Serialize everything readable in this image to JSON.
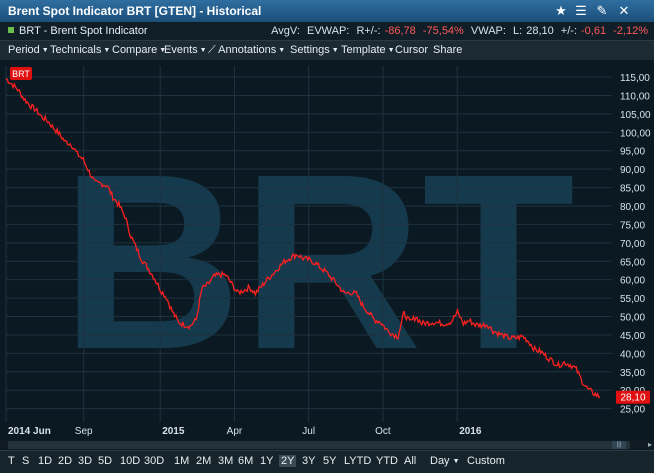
{
  "window": {
    "title": "Brent Spot Indicator BRT [GTEN] - Historical",
    "icons": [
      "star-icon",
      "menu-icon",
      "tool-icon",
      "close-icon"
    ]
  },
  "info": {
    "instrument": "BRT - Brent Spot Indicator",
    "avgv_label": "AvgV:",
    "evwap_label": "EVWAP:",
    "r_change_label": "R+/-:",
    "r_change_value": "-86,78",
    "r_change_pct": "-75,54%",
    "vwap_label": "VWAP:",
    "last_label": "L:",
    "last_value": "28,10",
    "change_label": "+/-:",
    "change_value": "-0,61",
    "change_pct": "-2,12%"
  },
  "menu": {
    "period": "Period",
    "technicals": "Technicals",
    "compare": "Compare",
    "events": "Events",
    "annotations": "Annotations",
    "settings": "Settings",
    "template": "Template",
    "cursor": "Cursor",
    "share": "Share"
  },
  "chart_data": {
    "type": "line",
    "watermark": "BRT",
    "series_tag": "BRT",
    "last_price_label": "28,10",
    "line_color": "#ff2020",
    "ylim": [
      23,
      118
    ],
    "y_ticks": [
      "25,00",
      "30,00",
      "35,00",
      "40,00",
      "45,00",
      "50,00",
      "55,00",
      "60,00",
      "65,00",
      "70,00",
      "75,00",
      "80,00",
      "85,00",
      "90,00",
      "95,00",
      "100,00",
      "105,00",
      "110,00",
      "115,00"
    ],
    "y_tick_values": [
      25,
      30,
      35,
      40,
      45,
      50,
      55,
      60,
      65,
      70,
      75,
      80,
      85,
      90,
      95,
      100,
      105,
      110,
      115
    ],
    "x_ticks": [
      {
        "label": "2014 Jun",
        "t": 0
      },
      {
        "label": "Sep",
        "t": 0.1308
      },
      {
        "label": "2015",
        "t": 0.2596
      },
      {
        "label": "Apr",
        "t": 0.3846
      },
      {
        "label": "Jul",
        "t": 0.5096
      },
      {
        "label": "Oct",
        "t": 0.6346
      },
      {
        "label": "2016",
        "t": 0.7596
      }
    ],
    "points": [
      [
        0.0,
        114.6
      ],
      [
        0.01,
        113.1
      ],
      [
        0.02,
        111.6
      ],
      [
        0.03,
        109.2
      ],
      [
        0.04,
        107.4
      ],
      [
        0.05,
        106.1
      ],
      [
        0.06,
        104.2
      ],
      [
        0.07,
        103.1
      ],
      [
        0.08,
        101.2
      ],
      [
        0.09,
        99.5
      ],
      [
        0.1,
        97.4
      ],
      [
        0.11,
        96.8
      ],
      [
        0.12,
        94.1
      ],
      [
        0.13,
        92.6
      ],
      [
        0.14,
        89.3
      ],
      [
        0.15,
        86.2
      ],
      [
        0.16,
        86.1
      ],
      [
        0.17,
        85.6
      ],
      [
        0.18,
        82.4
      ],
      [
        0.19,
        80.3
      ],
      [
        0.2,
        77.3
      ],
      [
        0.21,
        71.9
      ],
      [
        0.22,
        68.4
      ],
      [
        0.23,
        65.1
      ],
      [
        0.24,
        62.9
      ],
      [
        0.25,
        60.4
      ],
      [
        0.26,
        57.3
      ],
      [
        0.27,
        55.2
      ],
      [
        0.28,
        51.4
      ],
      [
        0.29,
        48.5
      ],
      [
        0.3,
        47.8
      ],
      [
        0.31,
        47.4
      ],
      [
        0.32,
        49.1
      ],
      [
        0.33,
        57.6
      ],
      [
        0.34,
        58.7
      ],
      [
        0.35,
        60.8
      ],
      [
        0.36,
        61.4
      ],
      [
        0.37,
        61.2
      ],
      [
        0.38,
        58.9
      ],
      [
        0.39,
        56.4
      ],
      [
        0.4,
        57.1
      ],
      [
        0.41,
        57.9
      ],
      [
        0.42,
        56.3
      ],
      [
        0.43,
        58.2
      ],
      [
        0.44,
        60.1
      ],
      [
        0.45,
        61.7
      ],
      [
        0.46,
        63.5
      ],
      [
        0.47,
        65.1
      ],
      [
        0.48,
        66.1
      ],
      [
        0.49,
        66.9
      ],
      [
        0.5,
        65.8
      ],
      [
        0.51,
        65.4
      ],
      [
        0.52,
        64.6
      ],
      [
        0.53,
        63.2
      ],
      [
        0.54,
        61.9
      ],
      [
        0.55,
        60.1
      ],
      [
        0.56,
        58.2
      ],
      [
        0.57,
        56.2
      ],
      [
        0.58,
        56.6
      ],
      [
        0.59,
        56.1
      ],
      [
        0.6,
        53.1
      ],
      [
        0.61,
        51.2
      ],
      [
        0.62,
        49.1
      ],
      [
        0.63,
        48.6
      ],
      [
        0.64,
        46.6
      ],
      [
        0.65,
        45.3
      ],
      [
        0.66,
        44.6
      ],
      [
        0.67,
        50.9
      ],
      [
        0.68,
        48.5
      ],
      [
        0.69,
        49.9
      ],
      [
        0.7,
        48.1
      ],
      [
        0.71,
        48.3
      ],
      [
        0.72,
        48.5
      ],
      [
        0.73,
        48.2
      ],
      [
        0.74,
        48.1
      ],
      [
        0.75,
        48.7
      ],
      [
        0.76,
        51.2
      ],
      [
        0.77,
        48.1
      ],
      [
        0.78,
        48.9
      ],
      [
        0.79,
        47.8
      ],
      [
        0.8,
        47.6
      ],
      [
        0.81,
        47.9
      ],
      [
        0.82,
        46.1
      ],
      [
        0.83,
        45.3
      ],
      [
        0.84,
        44.6
      ],
      [
        0.85,
        44.1
      ],
      [
        0.86,
        44.2
      ],
      [
        0.87,
        44.6
      ],
      [
        0.88,
        43.2
      ],
      [
        0.89,
        41.1
      ],
      [
        0.9,
        40.5
      ],
      [
        0.91,
        39.1
      ],
      [
        0.92,
        37.9
      ],
      [
        0.93,
        36.8
      ],
      [
        0.94,
        37.5
      ],
      [
        0.95,
        36.9
      ],
      [
        0.96,
        35.7
      ],
      [
        0.97,
        32.4
      ],
      [
        0.98,
        30.2
      ],
      [
        0.99,
        29.1
      ],
      [
        1.0,
        28.1
      ]
    ]
  },
  "footer": {
    "ranges": [
      "T",
      "S",
      "1D",
      "2D",
      "3D",
      "5D",
      "10D",
      "30D",
      "1M",
      "2M",
      "3M",
      "6M",
      "1Y",
      "2Y",
      "3Y",
      "5Y",
      "LYTD",
      "YTD",
      "All"
    ],
    "active_range": "2Y",
    "interval": "Day",
    "custom": "Custom"
  }
}
